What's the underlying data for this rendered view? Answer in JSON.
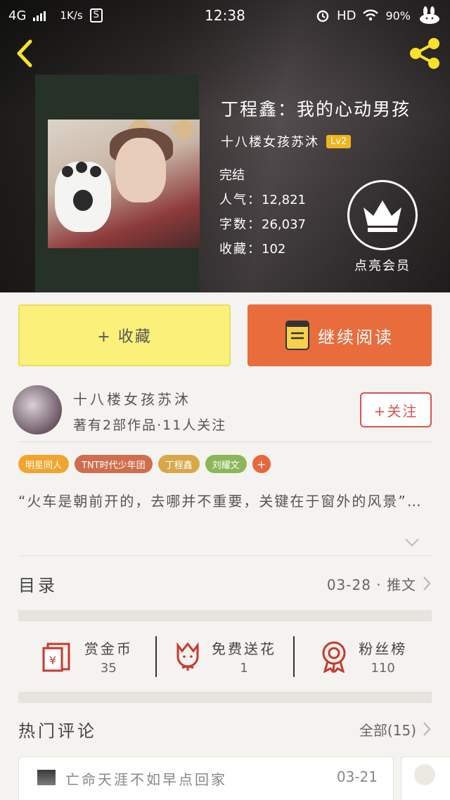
{
  "status_bar": {
    "network": "4G",
    "speed": "1K/s",
    "sim_badge": "S",
    "time": "12:38",
    "hd": "HD",
    "battery": "90%"
  },
  "book": {
    "title": "丁程鑫：我的心动男孩",
    "author": "十八楼女孩苏沐",
    "author_level": "Lv2",
    "status": "完结",
    "popularity_label": "人气：",
    "popularity": "12,821",
    "words_label": "字数：",
    "words": "26,037",
    "favorites_label": "收藏：",
    "favorites": "102"
  },
  "vip": {
    "label": "点亮会员"
  },
  "actions": {
    "favorite": "+ 收藏",
    "continue_reading": "继续阅读"
  },
  "author_card": {
    "name": "十八楼女孩苏沐",
    "meta": "著有2部作品·11人关注",
    "follow": "+关注"
  },
  "tags": [
    {
      "label": "明星同人",
      "color": "#f1a52e"
    },
    {
      "label": "TNT时代少年团",
      "color": "#cf6d4e"
    },
    {
      "label": "丁程鑫",
      "color": "#d7a74a"
    },
    {
      "label": "刘耀文",
      "color": "#8db65a"
    },
    {
      "label": "+",
      "color": "#e8663d"
    }
  ],
  "summary": "“火车是朝前开的，去哪并不重要，关键在于窗外的风景”…",
  "toc": {
    "label": "目录",
    "info": "03-28 · 推文"
  },
  "rewards": [
    {
      "label": "赏金币",
      "value": "35",
      "icon": "red-envelope-icon"
    },
    {
      "label": "免费送花",
      "value": "1",
      "icon": "flower-icon"
    },
    {
      "label": "粉丝榜",
      "value": "110",
      "icon": "medal-icon"
    }
  ],
  "comments_section": {
    "label": "热门评论",
    "all": "全部(15)"
  },
  "comments": [
    {
      "user": "亡命天涯不如早点回家",
      "date": "03-21"
    }
  ],
  "colors": {
    "accent_red": "#d9534f",
    "read_orange": "#e96c3c",
    "fav_yellow": "#fbf07a",
    "level_gold": "#f0b51c"
  }
}
